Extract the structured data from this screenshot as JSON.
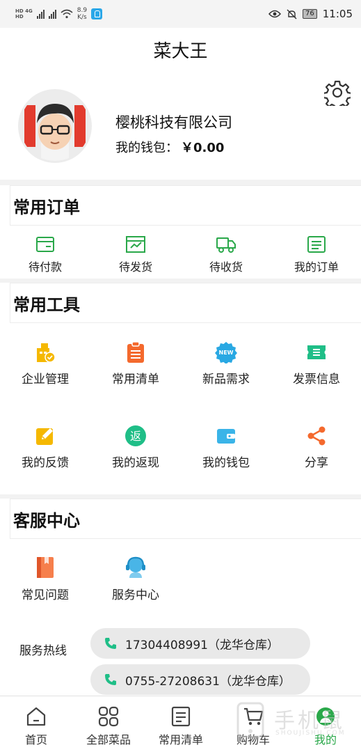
{
  "status_bar": {
    "network_top": "HD 4G",
    "network_bottom": "HD",
    "speed_value": "8.9",
    "speed_unit": "K/s",
    "battery": "76",
    "time": "11:05"
  },
  "header": {
    "title": "菜大王"
  },
  "profile": {
    "company": "樱桃科技有限公司",
    "wallet_label": "我的钱包：",
    "wallet_amount": "￥0.00"
  },
  "orders": {
    "title": "常用订单",
    "items": [
      {
        "label": "待付款",
        "icon": "pending-payment-icon"
      },
      {
        "label": "待发货",
        "icon": "pending-shipment-icon"
      },
      {
        "label": "待收货",
        "icon": "truck-icon"
      },
      {
        "label": "我的订单",
        "icon": "order-list-icon"
      }
    ]
  },
  "tools": {
    "title": "常用工具",
    "items": [
      {
        "label": "企业管理",
        "icon": "enterprise-icon",
        "color": "#f5b800"
      },
      {
        "label": "常用清单",
        "icon": "clipboard-icon",
        "color": "#f4692d"
      },
      {
        "label": "新品需求",
        "icon": "new-badge-icon",
        "color": "#29a8e3"
      },
      {
        "label": "发票信息",
        "icon": "invoice-icon",
        "color": "#1fbe87"
      },
      {
        "label": "我的反馈",
        "icon": "feedback-icon",
        "color": "#f5b800"
      },
      {
        "label": "我的返现",
        "icon": "cashback-icon",
        "color": "#1fbe87",
        "glyph": "返"
      },
      {
        "label": "我的钱包",
        "icon": "wallet-icon",
        "color": "#3ab4e8"
      },
      {
        "label": "分享",
        "icon": "share-icon",
        "color": "#f4692d"
      }
    ]
  },
  "service": {
    "title": "客服中心",
    "items": [
      {
        "label": "常见问题",
        "icon": "faq-book-icon",
        "color": "#f4692d"
      },
      {
        "label": "服务中心",
        "icon": "customer-service-icon",
        "color": "#29a8e3"
      }
    ],
    "hotline_label": "服务热线",
    "phones": [
      "17304408991（龙华仓库）",
      "0755-27208631（龙华仓库）"
    ]
  },
  "tabbar": {
    "items": [
      {
        "label": "首页",
        "icon": "home-icon"
      },
      {
        "label": "全部菜品",
        "icon": "grid-icon"
      },
      {
        "label": "常用清单",
        "icon": "list-icon"
      },
      {
        "label": "购物车",
        "icon": "cart-icon"
      },
      {
        "label": "我的",
        "icon": "profile-icon",
        "active": true
      }
    ]
  },
  "watermark": {
    "text": "手机鼠",
    "sub": "SHOUJISHU.COM"
  },
  "colors": {
    "accent": "#2aa84a",
    "order_icon": "#2aa84a"
  }
}
